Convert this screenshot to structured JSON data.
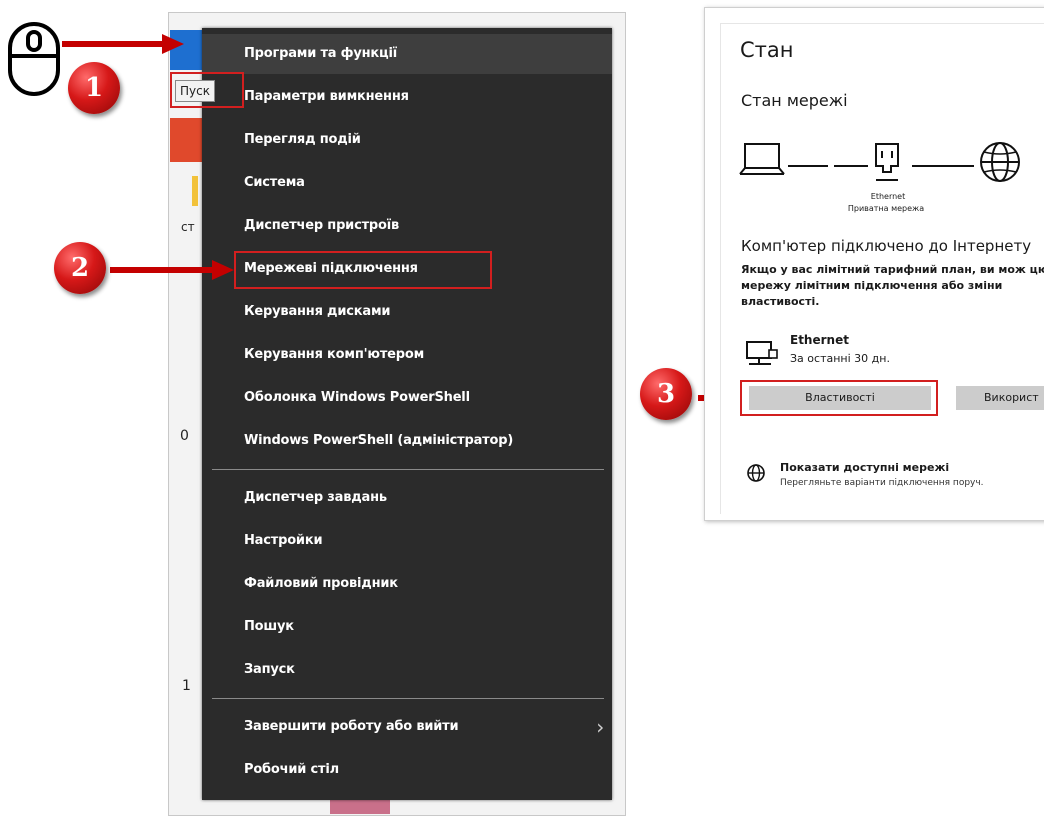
{
  "start_menu": {
    "tooltip": "Пуск",
    "items": [
      {
        "label": "Програми та функції"
      },
      {
        "label": "Параметри вимкнення"
      },
      {
        "label": "Перегляд подій"
      },
      {
        "label": "Система"
      },
      {
        "label": "Диспетчер пристроїв"
      },
      {
        "label": "Мережеві підключення"
      },
      {
        "label": "Керування дисками"
      },
      {
        "label": "Керування комп'ютером"
      },
      {
        "label": "Оболонка Windows PowerShell"
      },
      {
        "label": "Windows PowerShell (адміністратор)"
      },
      {
        "label": "Диспетчер завдань"
      },
      {
        "label": "Настройки"
      },
      {
        "label": "Файловий провідник"
      },
      {
        "label": "Пошук"
      },
      {
        "label": "Запуск"
      },
      {
        "label": "Завершити роботу або вийти"
      },
      {
        "label": "Робочий стіл"
      }
    ],
    "edge_fragments": {
      "st": "ст",
      "zero": "0",
      "one": "1"
    }
  },
  "steps": {
    "one": "1",
    "two": "2",
    "three": "3"
  },
  "settings": {
    "title": "Стан",
    "network_status": "Стан мережі",
    "ethernet_small": "Ethernet",
    "private_network": "Приватна мережа",
    "connected_heading": "Комп'ютер підключено до Інтернету",
    "metered_text": "Якщо у вас лімітний тарифний план, ви мож цю мережу лімітним підключення або зміни властивості.",
    "adapter_name": "Ethernet",
    "adapter_period": "За останні 30 дн.",
    "properties_button": "Властивості",
    "usage_button": "Використ",
    "show_networks": "Показати доступні мережі",
    "show_networks_desc": "Перегляньте варіанти підключення поруч."
  },
  "colors": {
    "menu_bg": "#2b2b2b",
    "highlight": "#d21f1f",
    "button": "#cccccc"
  }
}
